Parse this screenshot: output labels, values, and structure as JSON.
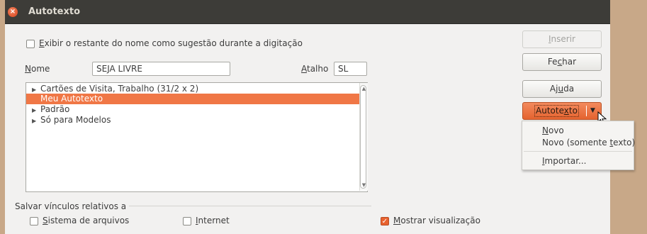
{
  "window": {
    "title": "Autotexto"
  },
  "options": {
    "show_remainder_prefix": "",
    "show_remainder_key": "E",
    "show_remainder_rest": "xibir o restante do nome como sugestão durante a digitação"
  },
  "fields": {
    "name_key": "N",
    "name_rest": "ome",
    "name_value": "SEJA LIVRE",
    "shortcut_key": "A",
    "shortcut_rest": "talho",
    "shortcut_value": "SL"
  },
  "list": {
    "items": [
      {
        "label": "Cartões de Visita, Trabalho (31/2 x 2)",
        "expandable": true,
        "selected": false
      },
      {
        "label": "Meu Autotexto",
        "expandable": false,
        "selected": true
      },
      {
        "label": "Padrão",
        "expandable": true,
        "selected": false
      },
      {
        "label": "Só para Modelos",
        "expandable": true,
        "selected": false
      }
    ]
  },
  "buttons": {
    "insert": {
      "key": "I",
      "rest": "nserir"
    },
    "close": {
      "pre": "Fe",
      "key": "c",
      "rest": "har"
    },
    "help": {
      "pre": "Aj",
      "key": "u",
      "rest": "da"
    },
    "autotext": {
      "pre": "Autote",
      "key": "x",
      "rest": "to"
    }
  },
  "menu": {
    "new": {
      "key": "N",
      "rest": "ovo"
    },
    "new_text": {
      "pre": "Novo (somente ",
      "key": "t",
      "rest": "exto)"
    },
    "import": {
      "key": "I",
      "rest": "mportar..."
    }
  },
  "save_links": {
    "group_label": "Salvar vínculos relativos a",
    "filesystem": {
      "key": "S",
      "rest": "istema de arquivos",
      "checked": false
    },
    "internet": {
      "key": "I",
      "rest": "nternet",
      "checked": false
    },
    "preview": {
      "key": "M",
      "rest": "ostrar visualização",
      "checked": true
    }
  }
}
